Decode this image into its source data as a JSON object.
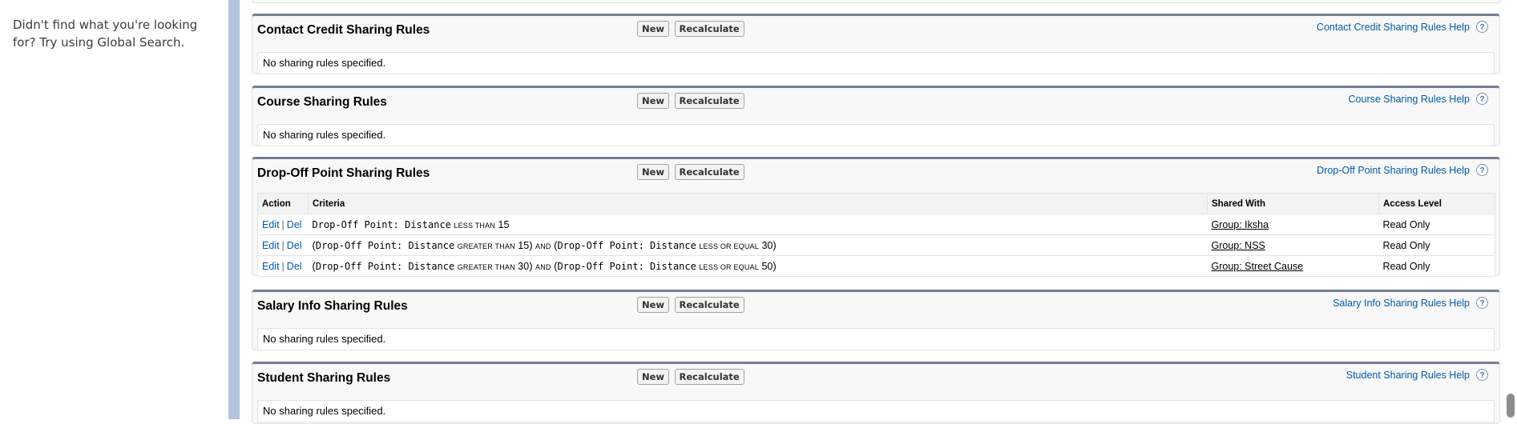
{
  "sidebar": {
    "not_found_text": "Didn't find what you're looking for? Try using Global Search."
  },
  "buttons": {
    "new": "New",
    "recalculate": "Recalculate"
  },
  "help_icon_glyph": "?",
  "empty_message": "No sharing rules specified.",
  "sections": {
    "contact_credit": {
      "title": "Contact Credit Sharing Rules",
      "help": "Contact Credit Sharing Rules Help"
    },
    "course": {
      "title": "Course Sharing Rules",
      "help": "Course Sharing Rules Help"
    },
    "drop_off": {
      "title": "Drop-Off Point Sharing Rules",
      "help": "Drop-Off Point Sharing Rules Help",
      "columns": {
        "action": "Action",
        "criteria": "Criteria",
        "shared_with": "Shared With",
        "access_level": "Access Level"
      },
      "rows": [
        {
          "edit": "Edit",
          "del": "Del",
          "field": "Drop-Off Point: Distance",
          "op1": "LESS THAN",
          "val1": "15",
          "shared_with": "Group: Iksha",
          "access": "Read Only"
        },
        {
          "edit": "Edit",
          "del": "Del",
          "field": "Drop-Off Point: Distance",
          "op1": "GREATER THAN",
          "val1": "15",
          "and": "AND",
          "op2": "LESS OR EQUAL",
          "val2": "30",
          "shared_with": "Group: NSS",
          "access": "Read Only"
        },
        {
          "edit": "Edit",
          "del": "Del",
          "field": "Drop-Off Point: Distance",
          "op1": "GREATER THAN",
          "val1": "30",
          "and": "AND",
          "op2": "LESS OR EQUAL",
          "val2": "50",
          "shared_with": "Group: Street Cause",
          "access": "Read Only"
        }
      ]
    },
    "salary_info": {
      "title": "Salary Info Sharing Rules",
      "help": "Salary Info Sharing Rules Help"
    },
    "student": {
      "title": "Student Sharing Rules",
      "help": "Student Sharing Rules Help"
    }
  },
  "colors": {
    "link": "#015ba7",
    "section_top_border": "#747e96",
    "rail": "#b4c6dc",
    "section_bg": "#f8f8f8"
  }
}
